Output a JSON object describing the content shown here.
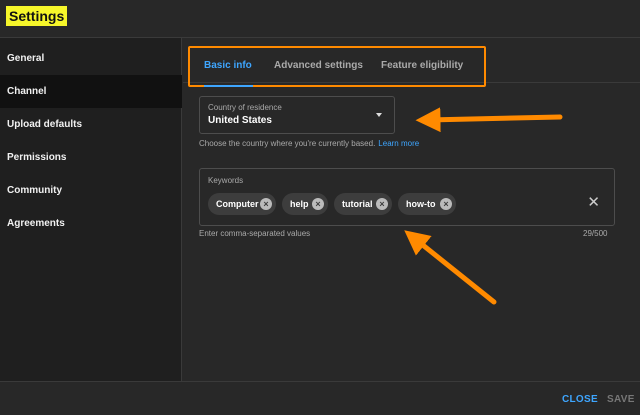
{
  "header": {
    "title": "Settings"
  },
  "sidebar": {
    "items": [
      {
        "label": "General",
        "active": false
      },
      {
        "label": "Channel",
        "active": true
      },
      {
        "label": "Upload defaults",
        "active": false
      },
      {
        "label": "Permissions",
        "active": false
      },
      {
        "label": "Community",
        "active": false
      },
      {
        "label": "Agreements",
        "active": false
      }
    ]
  },
  "tabs": [
    {
      "label": "Basic info",
      "active": true
    },
    {
      "label": "Advanced settings",
      "active": false
    },
    {
      "label": "Feature eligibility",
      "active": false
    }
  ],
  "country": {
    "label": "Country of residence",
    "value": "United States",
    "help": "Choose the country where you're currently based.",
    "help_link": "Learn more"
  },
  "keywords": {
    "label": "Keywords",
    "chips": [
      "Computer",
      "help",
      "tutorial",
      "how-to"
    ],
    "help": "Enter comma-separated values",
    "count": "29/500"
  },
  "footer": {
    "close_label": "CLOSE",
    "save_label": "SAVE"
  },
  "colors": {
    "accent": "#3ea6ff",
    "highlight_border": "#ff8a00",
    "title_highlight": "#f6f62a"
  }
}
